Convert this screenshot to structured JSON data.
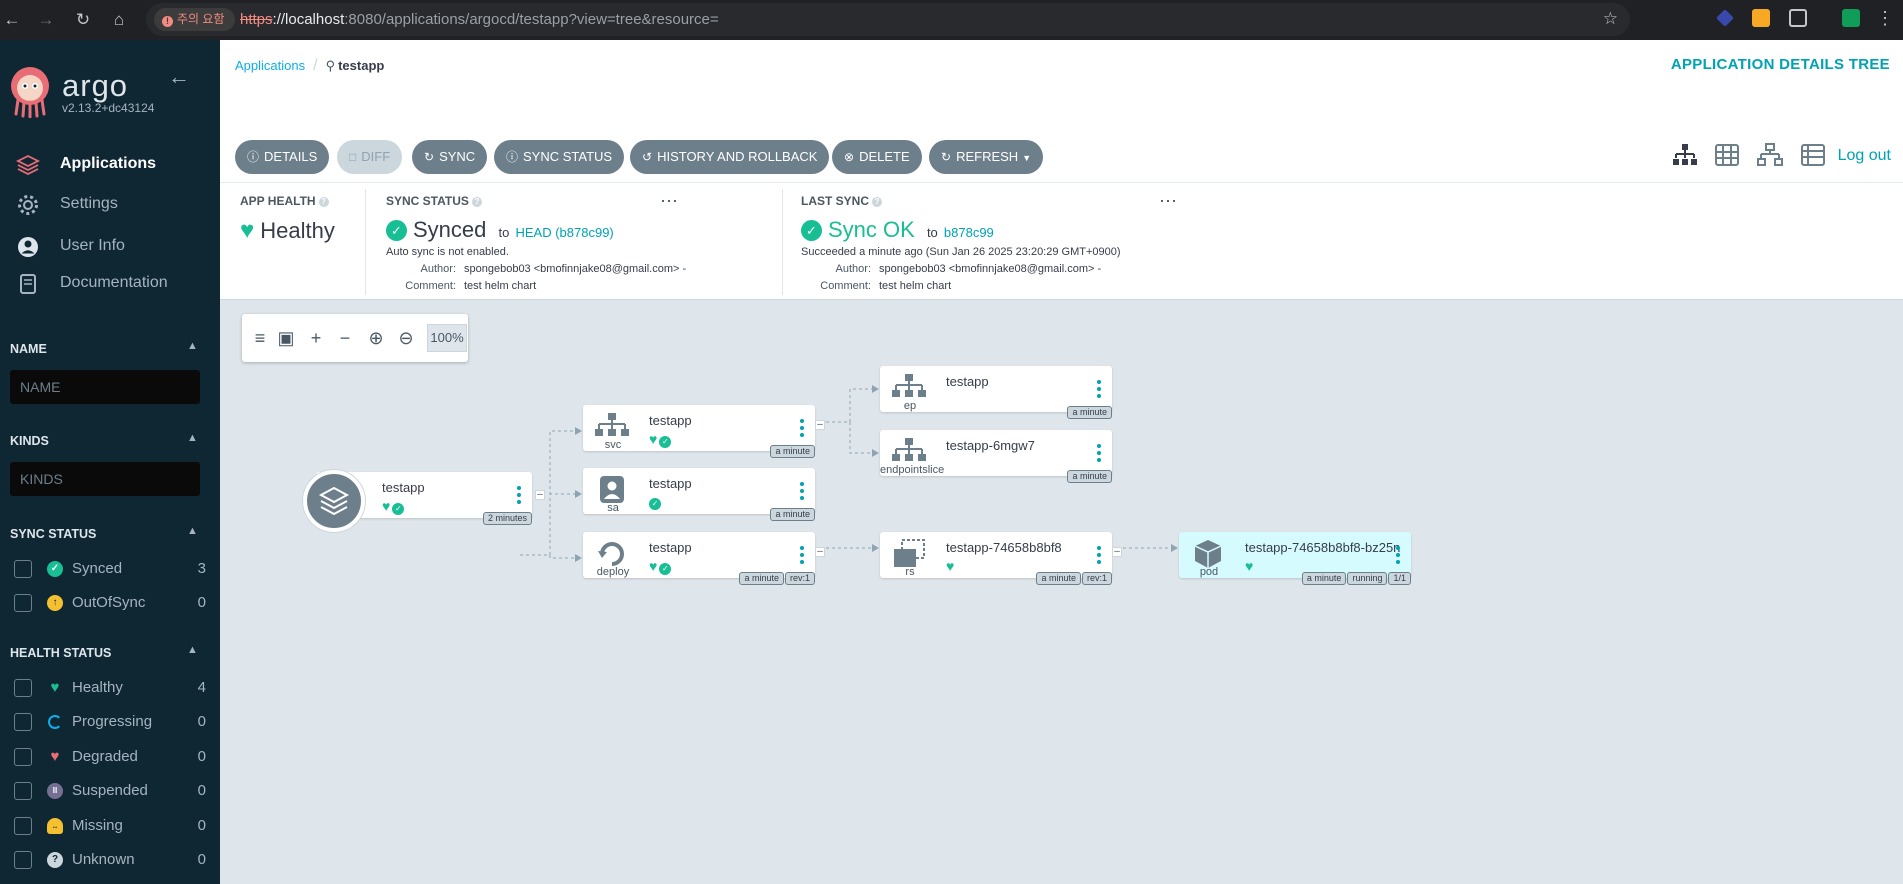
{
  "browser": {
    "security_chip": "주의 요함",
    "url_proto": "https",
    "url_host": "://localhost",
    "url_rest": ":8080/applications/argocd/testapp?view=tree&resource="
  },
  "sidebar": {
    "brand": "argo",
    "version": "v2.13.2+dc43124",
    "nav": [
      {
        "label": "Applications",
        "icon": "layers-icon",
        "active": true
      },
      {
        "label": "Settings",
        "icon": "gear-icon"
      },
      {
        "label": "User Info",
        "icon": "user-icon"
      },
      {
        "label": "Documentation",
        "icon": "book-icon"
      }
    ],
    "filters": {
      "name_header": "NAME",
      "name_placeholder": "NAME",
      "kinds_header": "KINDS",
      "kinds_placeholder": "KINDS",
      "sync_header": "SYNC STATUS",
      "sync": [
        {
          "label": "Synced",
          "count": "3",
          "color": "#18be94"
        },
        {
          "label": "OutOfSync",
          "count": "0",
          "color": "#f4c030"
        }
      ],
      "health_header": "HEALTH STATUS",
      "health": [
        {
          "label": "Healthy",
          "count": "4",
          "color": "#18be94"
        },
        {
          "label": "Progressing",
          "count": "0",
          "color": "#0dadea"
        },
        {
          "label": "Degraded",
          "count": "0",
          "color": "#e96d76"
        },
        {
          "label": "Suspended",
          "count": "0",
          "color": "#766f94"
        },
        {
          "label": "Missing",
          "count": "0",
          "color": "#f4c030"
        },
        {
          "label": "Unknown",
          "count": "0",
          "color": "#ccd6dd"
        }
      ]
    }
  },
  "breadcrumb": {
    "root": "Applications",
    "current": "testapp"
  },
  "page_title": "APPLICATION DETAILS TREE",
  "toolbar": {
    "details": "DETAILS",
    "diff": "DIFF",
    "sync": "SYNC",
    "sync_status": "SYNC STATUS",
    "history": "HISTORY AND ROLLBACK",
    "delete": "DELETE",
    "refresh": "REFRESH",
    "logout": "Log out"
  },
  "status": {
    "app_health": {
      "header": "APP HEALTH",
      "value": "Healthy"
    },
    "sync_status": {
      "header": "SYNC STATUS",
      "value": "Synced",
      "to": "to",
      "revision": "HEAD (b878c99)",
      "auto_sync": "Auto sync is not enabled.",
      "author_label": "Author:",
      "author": "spongebob03 <bmofinnjake08@gmail.com> -",
      "comment_label": "Comment:",
      "comment": "test helm chart"
    },
    "last_sync": {
      "header": "LAST SYNC",
      "value": "Sync OK",
      "to": "to",
      "revision": "b878c99",
      "succeeded": "Succeeded a minute ago (Sun Jan 26 2025 23:20:29 GMT+0900)",
      "author_label": "Author:",
      "author": "spongebob03 <bmofinnjake08@gmail.com> -",
      "comment_label": "Comment:",
      "comment": "test helm chart"
    }
  },
  "zoom": {
    "level": "100%"
  },
  "tree": {
    "app": {
      "name": "testapp",
      "age": "2 minutes"
    },
    "svc": {
      "name": "testapp",
      "kind": "svc",
      "age": "a minute"
    },
    "sa": {
      "name": "testapp",
      "kind": "sa",
      "age": "a minute"
    },
    "deploy": {
      "name": "testapp",
      "kind": "deploy",
      "age": "a minute",
      "rev": "rev:1"
    },
    "ep": {
      "name": "testapp",
      "kind": "ep",
      "age": "a minute"
    },
    "eps": {
      "name": "testapp-6mgw7",
      "kind": "endpointslice",
      "age": "a minute"
    },
    "rs": {
      "name": "testapp-74658b8bf8",
      "kind": "rs",
      "age": "a minute",
      "rev": "rev:1"
    },
    "pod": {
      "name": "testapp-74658b8bf8-bz25n",
      "kind": "pod",
      "age": "a minute",
      "state": "running",
      "ready": "1/1"
    }
  }
}
